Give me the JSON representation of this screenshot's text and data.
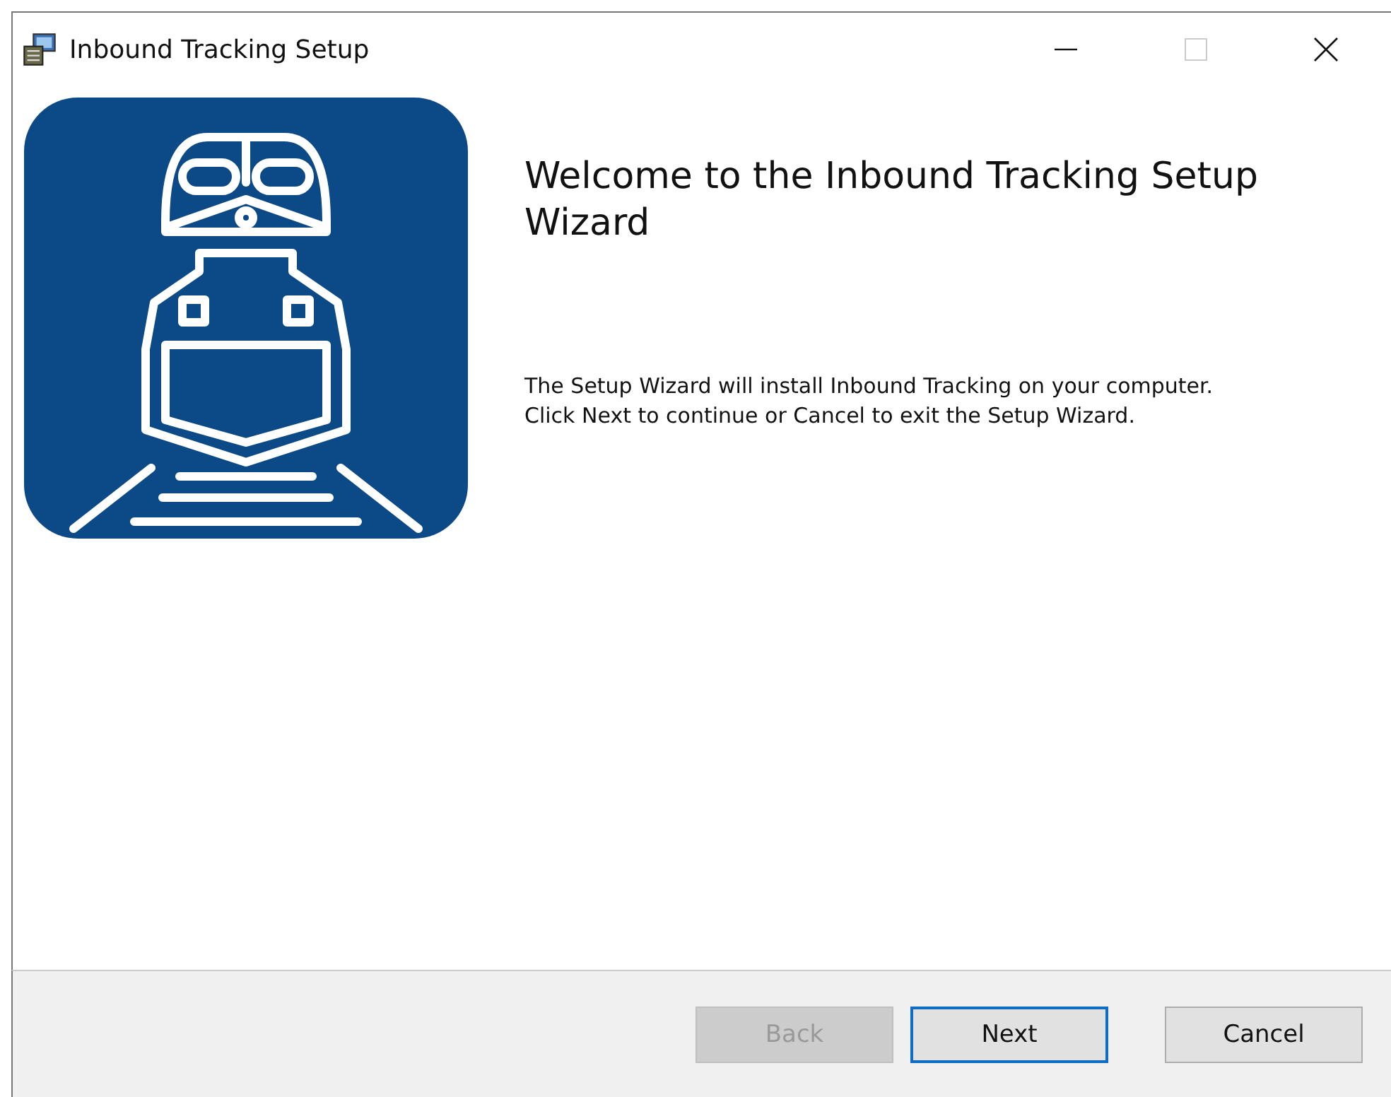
{
  "window": {
    "title": "Inbound Tracking Setup",
    "controls": [
      {
        "kind": "minimize",
        "disabled": false
      },
      {
        "kind": "maximize",
        "disabled": true
      },
      {
        "kind": "close",
        "disabled": false
      }
    ]
  },
  "welcome": {
    "heading": "Welcome to the Inbound Tracking Setup Wizard",
    "description": "The Setup Wizard will install Inbound Tracking on your computer. Click Next to continue or Cancel to exit the Setup Wizard."
  },
  "buttons": [
    {
      "label": "Back",
      "disabled": true,
      "focused": false
    },
    {
      "label": "Next",
      "disabled": false,
      "focused": true
    },
    {
      "label": "Cancel",
      "disabled": false,
      "focused": false
    }
  ]
}
